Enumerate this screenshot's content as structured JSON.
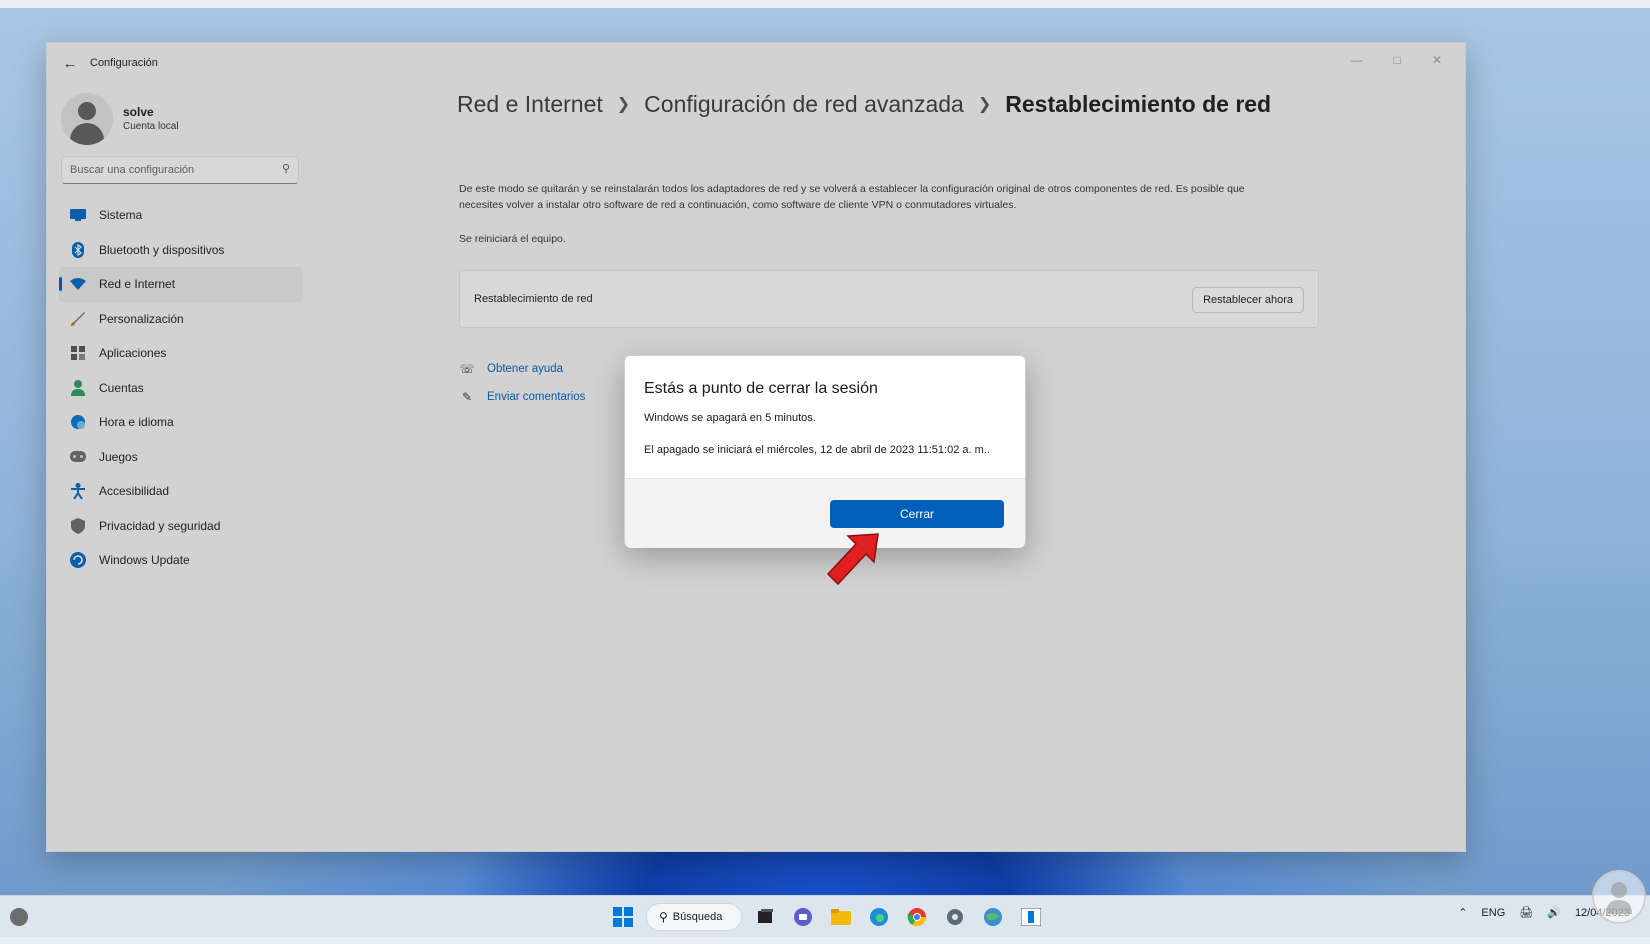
{
  "window": {
    "title": "Configuración",
    "back_icon": "arrow-left-icon",
    "controls": [
      "minimize-icon",
      "maximize-icon",
      "close-icon"
    ]
  },
  "profile": {
    "name": "solve",
    "account_type": "Cuenta local"
  },
  "search": {
    "placeholder": "Buscar una configuración"
  },
  "nav": {
    "items": [
      {
        "label": "Sistema",
        "icon": "monitor-icon",
        "color": "#0067c0"
      },
      {
        "label": "Bluetooth y dispositivos",
        "icon": "bluetooth-icon",
        "color": "#0067c0"
      },
      {
        "label": "Red e Internet",
        "icon": "wifi-icon",
        "color": "#0067c0",
        "active": true
      },
      {
        "label": "Personalización",
        "icon": "brush-icon",
        "color": "#c47a25"
      },
      {
        "label": "Aplicaciones",
        "icon": "apps-icon",
        "color": "#555555"
      },
      {
        "label": "Cuentas",
        "icon": "person-icon",
        "color": "#2b9d5c"
      },
      {
        "label": "Hora e idioma",
        "icon": "globe-clock-icon",
        "color": "#0078d4"
      },
      {
        "label": "Juegos",
        "icon": "gamepad-icon",
        "color": "#6b6b6b"
      },
      {
        "label": "Accesibilidad",
        "icon": "accessibility-icon",
        "color": "#0067c0"
      },
      {
        "label": "Privacidad y seguridad",
        "icon": "shield-icon",
        "color": "#6b6b6b"
      },
      {
        "label": "Windows Update",
        "icon": "update-icon",
        "color": "#0067c0"
      }
    ]
  },
  "content": {
    "breadcrumb": [
      "Red e Internet",
      "Configuración de red avanzada",
      "Restablecimiento de red"
    ],
    "description": "De este modo se quitarán y se reinstalarán todos los adaptadores de red y se volverá a establecer la configuración original de otros componentes de red. Es posible que necesites volver a instalar otro software de red a continuación, como software de cliente VPN o conmutadores virtuales.",
    "note": "Se reiniciará el equipo.",
    "card": {
      "label": "Restablecimiento de red",
      "button": "Restablecer ahora"
    },
    "links": [
      {
        "label": "Obtener ayuda",
        "icon": "help-icon"
      },
      {
        "label": "Enviar comentarios",
        "icon": "feedback-icon"
      }
    ]
  },
  "dialog": {
    "title": "Estás a punto de cerrar la sesión",
    "line1": "Windows se apagará en 5 minutos.",
    "line2": "El apagado se iniciará el miércoles, 12 de abril de 2023 11:51:02 a. m..",
    "button": "Cerrar",
    "button_color": "#005fb8"
  },
  "annotation": {
    "arrow_color": "#e02020"
  },
  "taskbar": {
    "search_label": "Búsqueda",
    "apps": [
      "windows-start-icon",
      "search-icon",
      "task-view-icon",
      "chat-icon",
      "file-explorer-icon",
      "edge-icon",
      "chrome-icon",
      "settings-icon",
      "globe-app-icon",
      "active-window-icon"
    ],
    "language": "ENG",
    "date": "12/04/2023"
  }
}
